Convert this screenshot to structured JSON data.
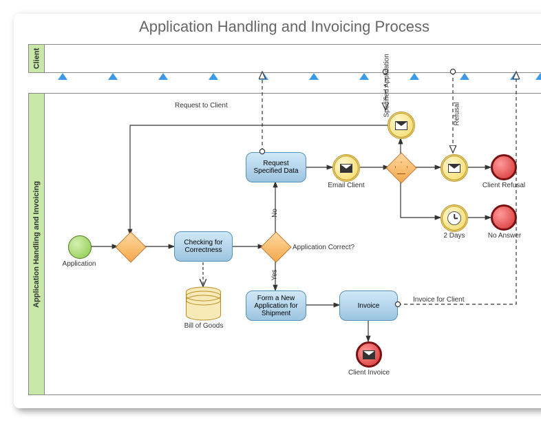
{
  "title": "Application Handling and Invoicing Process",
  "pools": {
    "client": "Client",
    "main": "Application Handling and Invoicing"
  },
  "nodes": {
    "application": "Application",
    "checking": "Checking for Correctness",
    "bill": "Bill of Goods",
    "request_data": "Request Specified Data",
    "email_client": "Email Client",
    "spec_app": "Specified Application",
    "refusal_flow": "Refusal",
    "client_refusal": "Client Refusal",
    "two_days": "2 Days",
    "no_answer": "No Answer",
    "form_shipment": "Form a New Application for Shipment",
    "invoice": "Invoice",
    "client_invoice": "Client Invoice"
  },
  "flows": {
    "request_to_client": "Request to Client",
    "app_correct": "Application Correct?",
    "yes": "Yes",
    "no": "No",
    "invoice_for_client": "Invoice for Client"
  },
  "chart_data": {
    "type": "bpmn",
    "pools": [
      {
        "id": "client",
        "name": "Client"
      },
      {
        "id": "main",
        "name": "Application Handling and Invoicing"
      }
    ],
    "nodes": [
      {
        "id": "start",
        "type": "start-event",
        "label": "Application",
        "pool": "main"
      },
      {
        "id": "gw1",
        "type": "exclusive-gateway",
        "pool": "main"
      },
      {
        "id": "check",
        "type": "task",
        "label": "Checking for Correctness",
        "pool": "main"
      },
      {
        "id": "bill",
        "type": "data-store",
        "label": "Bill of Goods",
        "pool": "main"
      },
      {
        "id": "gw2",
        "type": "exclusive-gateway",
        "label": "Application Correct?",
        "pool": "main"
      },
      {
        "id": "reqdata",
        "type": "task",
        "label": "Request Specified Data",
        "pool": "main"
      },
      {
        "id": "email",
        "type": "intermediate-message-throw",
        "label": "Email Client",
        "pool": "main"
      },
      {
        "id": "gw3",
        "type": "event-based-gateway",
        "pool": "main"
      },
      {
        "id": "specapp",
        "type": "intermediate-message-catch",
        "label": "Specified Application",
        "pool": "main"
      },
      {
        "id": "refusal",
        "type": "intermediate-message-catch",
        "label": "Refusal",
        "pool": "main"
      },
      {
        "id": "endrefusal",
        "type": "end-event",
        "label": "Client Refusal",
        "pool": "main"
      },
      {
        "id": "timer",
        "type": "intermediate-timer",
        "label": "2 Days",
        "pool": "main"
      },
      {
        "id": "endnoanswer",
        "type": "end-event",
        "label": "No Answer",
        "pool": "main"
      },
      {
        "id": "form",
        "type": "task",
        "label": "Form a New Application for Shipment",
        "pool": "main"
      },
      {
        "id": "invoice",
        "type": "task",
        "label": "Invoice",
        "pool": "main"
      },
      {
        "id": "endinvoice",
        "type": "end-message-event",
        "label": "Client Invoice",
        "pool": "main"
      }
    ],
    "sequence_flows": [
      {
        "from": "start",
        "to": "gw1"
      },
      {
        "from": "gw1",
        "to": "check"
      },
      {
        "from": "check",
        "to": "gw2"
      },
      {
        "from": "gw2",
        "to": "reqdata",
        "label": "No"
      },
      {
        "from": "gw2",
        "to": "form",
        "label": "Yes"
      },
      {
        "from": "reqdata",
        "to": "email"
      },
      {
        "from": "email",
        "to": "gw3"
      },
      {
        "from": "gw3",
        "to": "specapp"
      },
      {
        "from": "gw3",
        "to": "refusal"
      },
      {
        "from": "gw3",
        "to": "timer"
      },
      {
        "from": "refusal",
        "to": "endrefusal"
      },
      {
        "from": "timer",
        "to": "endnoanswer"
      },
      {
        "from": "specapp",
        "to": "gw1"
      },
      {
        "from": "form",
        "to": "invoice"
      },
      {
        "from": "invoice",
        "to": "endinvoice"
      }
    ],
    "message_flows": [
      {
        "from": "email",
        "to_pool": "client",
        "label": "Request to Client"
      },
      {
        "from_pool": "client",
        "to": "specapp",
        "label": "Specified Application"
      },
      {
        "from_pool": "client",
        "to": "refusal",
        "label": "Refusal"
      },
      {
        "from": "invoice",
        "to_pool": "client",
        "label": "Invoice for Client"
      }
    ],
    "data_associations": [
      {
        "from": "check",
        "to": "bill"
      }
    ]
  }
}
